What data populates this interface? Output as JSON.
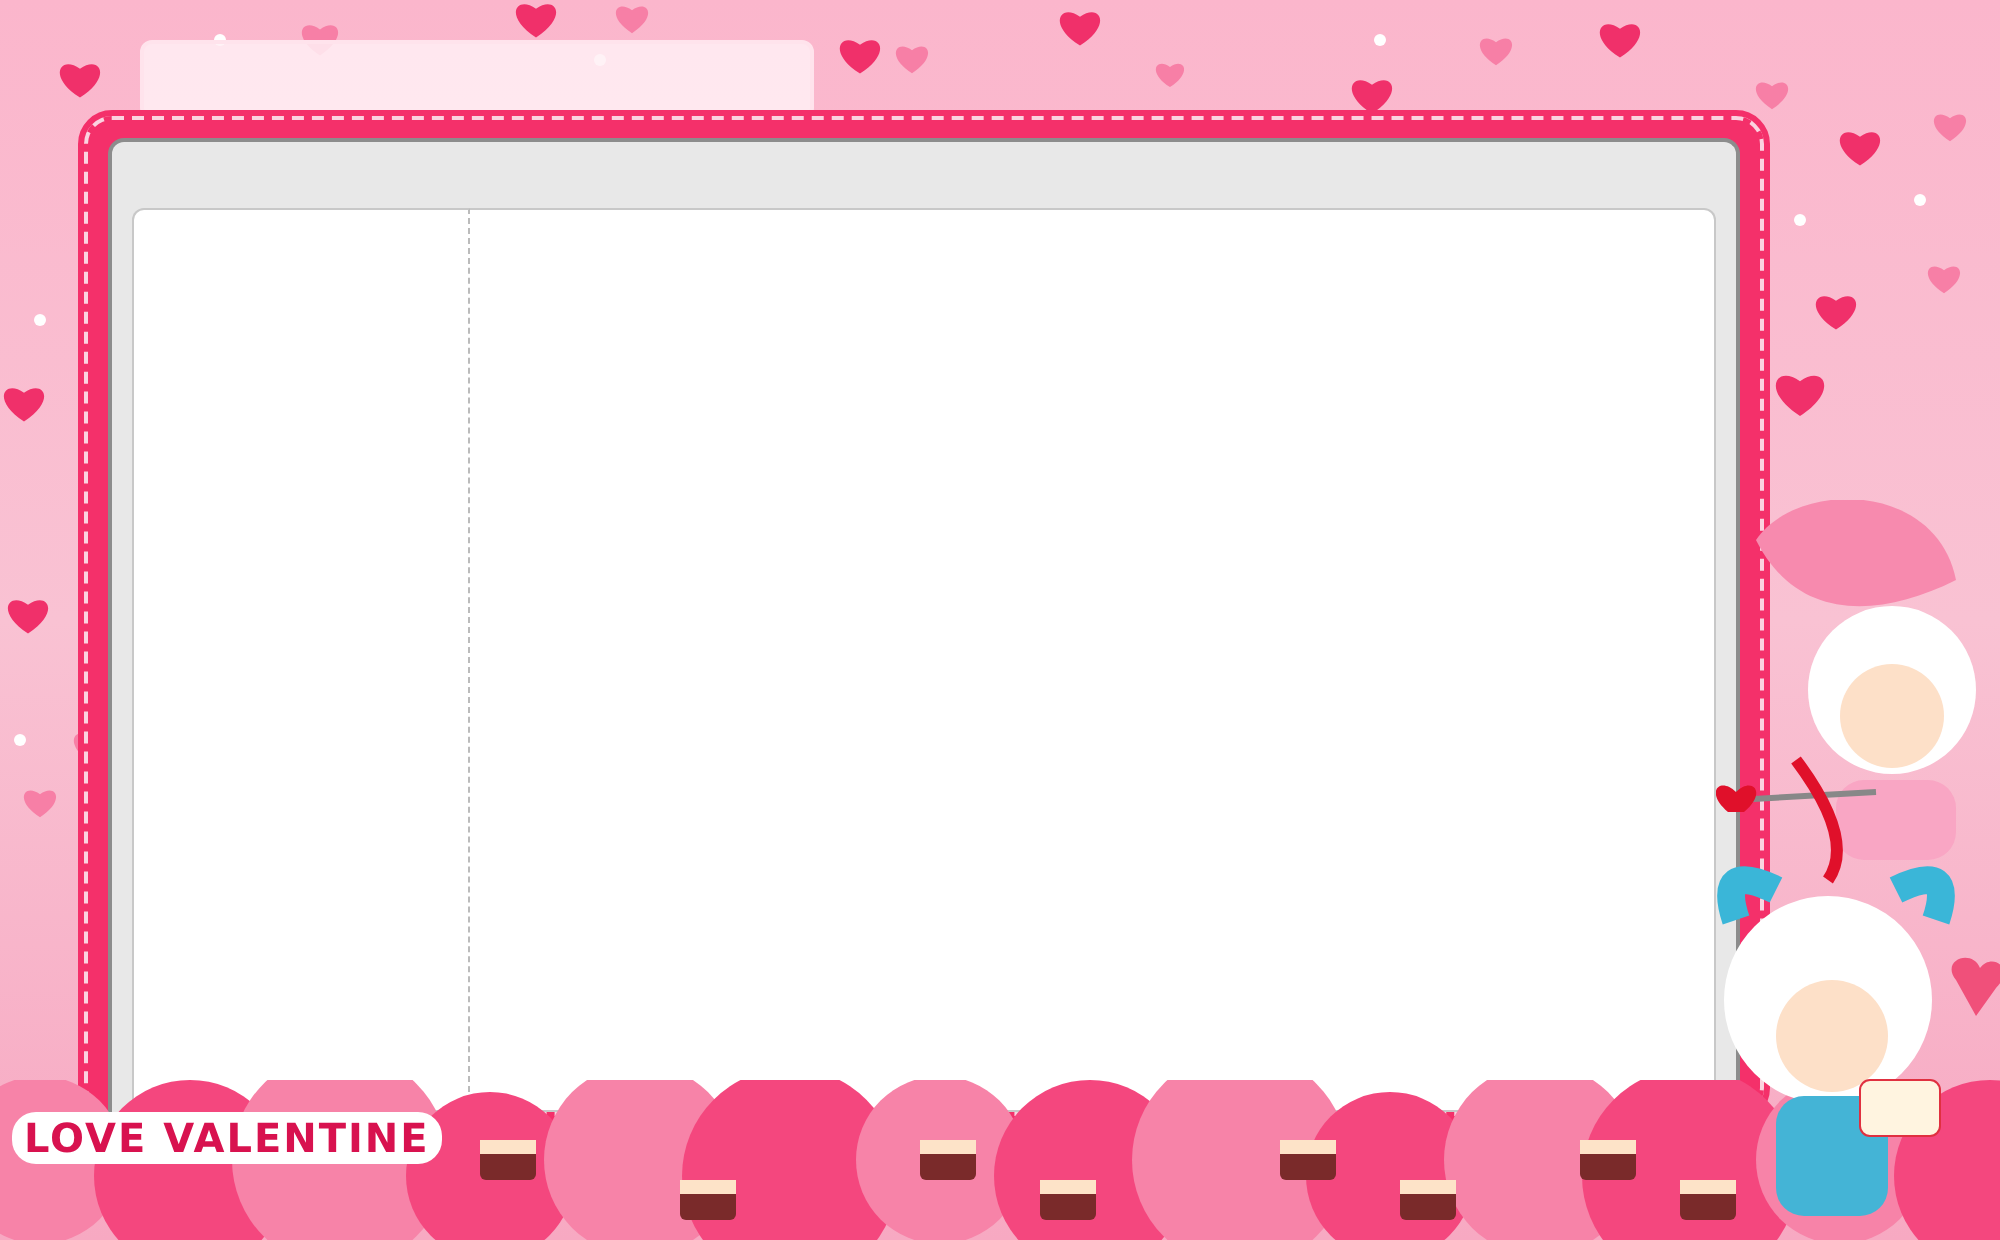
{
  "footer_banner": {
    "text": "LOVE VALENTINE"
  }
}
